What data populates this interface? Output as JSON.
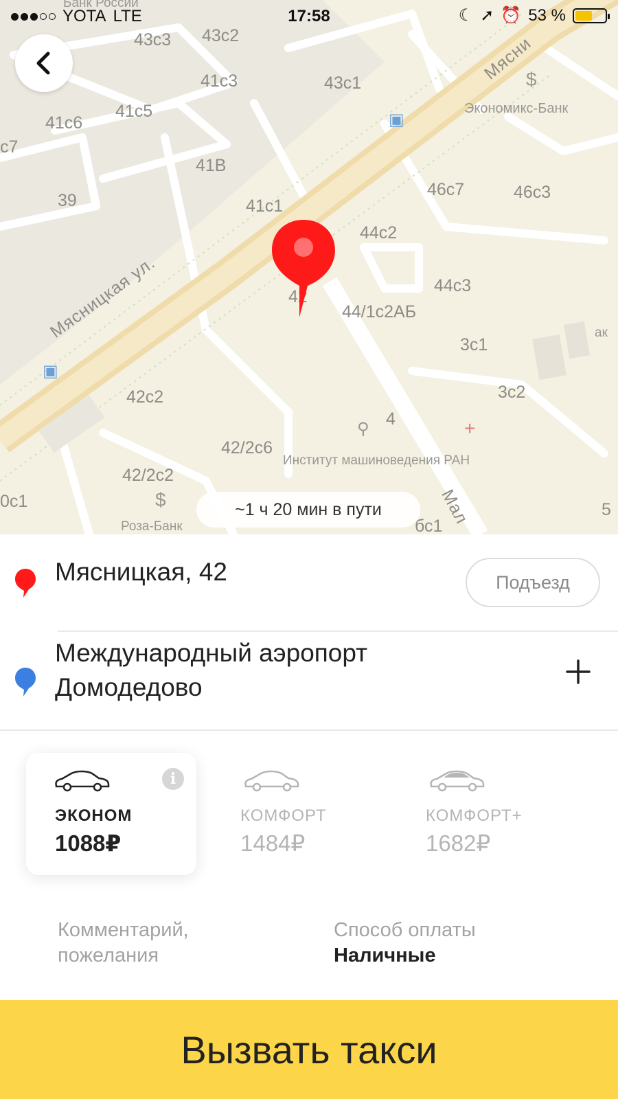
{
  "status_bar": {
    "carrier": "YOTA",
    "network": "LTE",
    "time": "17:58",
    "battery": "53 %",
    "battery_level": 0.53
  },
  "map": {
    "house_numbers": [
      "43c3",
      "43c2",
      "41c3",
      "43c1",
      "41c5",
      "41c6",
      "c7",
      "41B",
      "39",
      "41c1",
      "44c2",
      "46c7",
      "46c3",
      "44c3",
      "42",
      "44/1c2АБ",
      "3c1",
      "3c2",
      "42c2",
      "4",
      "42/2c6",
      "42/2c2",
      "0c1",
      "бс1",
      "5"
    ],
    "street_labels": [
      "Мясницкая ул.",
      "Мясни",
      "Мал"
    ],
    "poi_labels": {
      "bank_top": "Банк России",
      "economix": "Экономикс-Банк",
      "institute": "Институт машиноведения РАН",
      "rosa_bank": "Роза-Банк",
      "ak": "ак"
    },
    "eta": "~1 ч 20 мин в пути"
  },
  "route": {
    "from": "Мясницкая, 42",
    "entrance_label": "Подъезд",
    "to_line1": "Международный аэропорт",
    "to_line2": "Домодедово"
  },
  "tariffs": [
    {
      "name": "ЭКОНОМ",
      "price": "1088₽",
      "selected": true
    },
    {
      "name": "КОМФОРТ",
      "price": "1484₽",
      "selected": false
    },
    {
      "name": "КОМФОРТ+",
      "price": "1682₽",
      "selected": false
    }
  ],
  "options": {
    "comment_line1": "Комментарий,",
    "comment_line2": "пожелания",
    "payment_label": "Способ оплаты",
    "payment_value": "Наличные"
  },
  "call_button": "Вызвать такси",
  "colors": {
    "accent": "#fcd648",
    "pin_red": "#ff1a1a",
    "pin_blue": "#3d7fe0"
  }
}
